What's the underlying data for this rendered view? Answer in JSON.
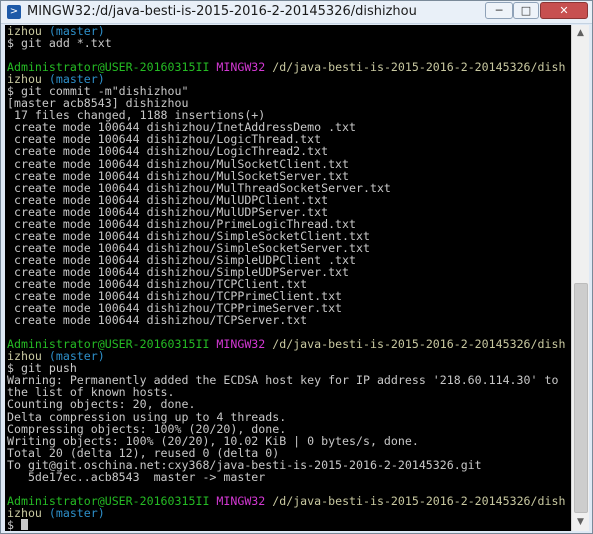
{
  "window": {
    "title": "MINGW32:/d/java-besti-is-2015-2016-2-20145326/dishizhou",
    "icon": "terminal-app-icon",
    "min_glyph": "─",
    "max_glyph": "□",
    "close_glyph": "✕"
  },
  "colors": {
    "user_host": "#25bc24",
    "mingw": "#d338d3",
    "branch": "#2d8fc9",
    "text": "#c8c8c8",
    "background": "#000000"
  },
  "terminal": {
    "lines": [
      {
        "kind": "branchline",
        "prefix": "izhou ",
        "branch": "(master)"
      },
      {
        "kind": "plain",
        "text": "$ git add *.txt"
      },
      {
        "kind": "plain",
        "text": ""
      },
      {
        "kind": "prompt",
        "user": "Administrator@USER-20160315II",
        "host": "MINGW32",
        "path": "/d/java-besti-is-2015-2016-2-20145326/dish"
      },
      {
        "kind": "branchline",
        "prefix": "izhou ",
        "branch": "(master)"
      },
      {
        "kind": "plain",
        "text": "$ git commit -m\"dishizhou\""
      },
      {
        "kind": "plain",
        "text": "[master acb8543] dishizhou"
      },
      {
        "kind": "plain",
        "text": " 17 files changed, 1188 insertions(+)"
      },
      {
        "kind": "plain",
        "text": " create mode 100644 dishizhou/InetAddressDemo .txt"
      },
      {
        "kind": "plain",
        "text": " create mode 100644 dishizhou/LogicThread.txt"
      },
      {
        "kind": "plain",
        "text": " create mode 100644 dishizhou/LogicThread2.txt"
      },
      {
        "kind": "plain",
        "text": " create mode 100644 dishizhou/MulSocketClient.txt"
      },
      {
        "kind": "plain",
        "text": " create mode 100644 dishizhou/MulSocketServer.txt"
      },
      {
        "kind": "plain",
        "text": " create mode 100644 dishizhou/MulThreadSocketServer.txt"
      },
      {
        "kind": "plain",
        "text": " create mode 100644 dishizhou/MulUDPClient.txt"
      },
      {
        "kind": "plain",
        "text": " create mode 100644 dishizhou/MulUDPServer.txt"
      },
      {
        "kind": "plain",
        "text": " create mode 100644 dishizhou/PrimeLogicThread.txt"
      },
      {
        "kind": "plain",
        "text": " create mode 100644 dishizhou/SimpleSocketClient.txt"
      },
      {
        "kind": "plain",
        "text": " create mode 100644 dishizhou/SimpleSocketServer.txt"
      },
      {
        "kind": "plain",
        "text": " create mode 100644 dishizhou/SimpleUDPClient .txt"
      },
      {
        "kind": "plain",
        "text": " create mode 100644 dishizhou/SimpleUDPServer.txt"
      },
      {
        "kind": "plain",
        "text": " create mode 100644 dishizhou/TCPClient.txt"
      },
      {
        "kind": "plain",
        "text": " create mode 100644 dishizhou/TCPPrimeClient.txt"
      },
      {
        "kind": "plain",
        "text": " create mode 100644 dishizhou/TCPPrimeServer.txt"
      },
      {
        "kind": "plain",
        "text": " create mode 100644 dishizhou/TCPServer.txt"
      },
      {
        "kind": "plain",
        "text": ""
      },
      {
        "kind": "prompt",
        "user": "Administrator@USER-20160315II",
        "host": "MINGW32",
        "path": "/d/java-besti-is-2015-2016-2-20145326/dish"
      },
      {
        "kind": "branchline",
        "prefix": "izhou ",
        "branch": "(master)"
      },
      {
        "kind": "plain",
        "text": "$ git push"
      },
      {
        "kind": "plain",
        "text": "Warning: Permanently added the ECDSA host key for IP address '218.60.114.30' to"
      },
      {
        "kind": "plain",
        "text": "the list of known hosts."
      },
      {
        "kind": "plain",
        "text": "Counting objects: 20, done."
      },
      {
        "kind": "plain",
        "text": "Delta compression using up to 4 threads."
      },
      {
        "kind": "plain",
        "text": "Compressing objects: 100% (20/20), done."
      },
      {
        "kind": "plain",
        "text": "Writing objects: 100% (20/20), 10.02 KiB | 0 bytes/s, done."
      },
      {
        "kind": "plain",
        "text": "Total 20 (delta 12), reused 0 (delta 0)"
      },
      {
        "kind": "plain",
        "text": "To git@git.oschina.net:cxy368/java-besti-is-2015-2016-2-20145326.git"
      },
      {
        "kind": "plain",
        "text": "   5de17ec..acb8543  master -> master"
      },
      {
        "kind": "plain",
        "text": ""
      },
      {
        "kind": "prompt",
        "user": "Administrator@USER-20160315II",
        "host": "MINGW32",
        "path": "/d/java-besti-is-2015-2016-2-20145326/dish"
      },
      {
        "kind": "branchline",
        "prefix": "izhou ",
        "branch": "(master)"
      },
      {
        "kind": "cursorline",
        "text": "$ "
      }
    ]
  },
  "scrollbar": {
    "up_glyph": "▲",
    "down_glyph": "▼"
  }
}
